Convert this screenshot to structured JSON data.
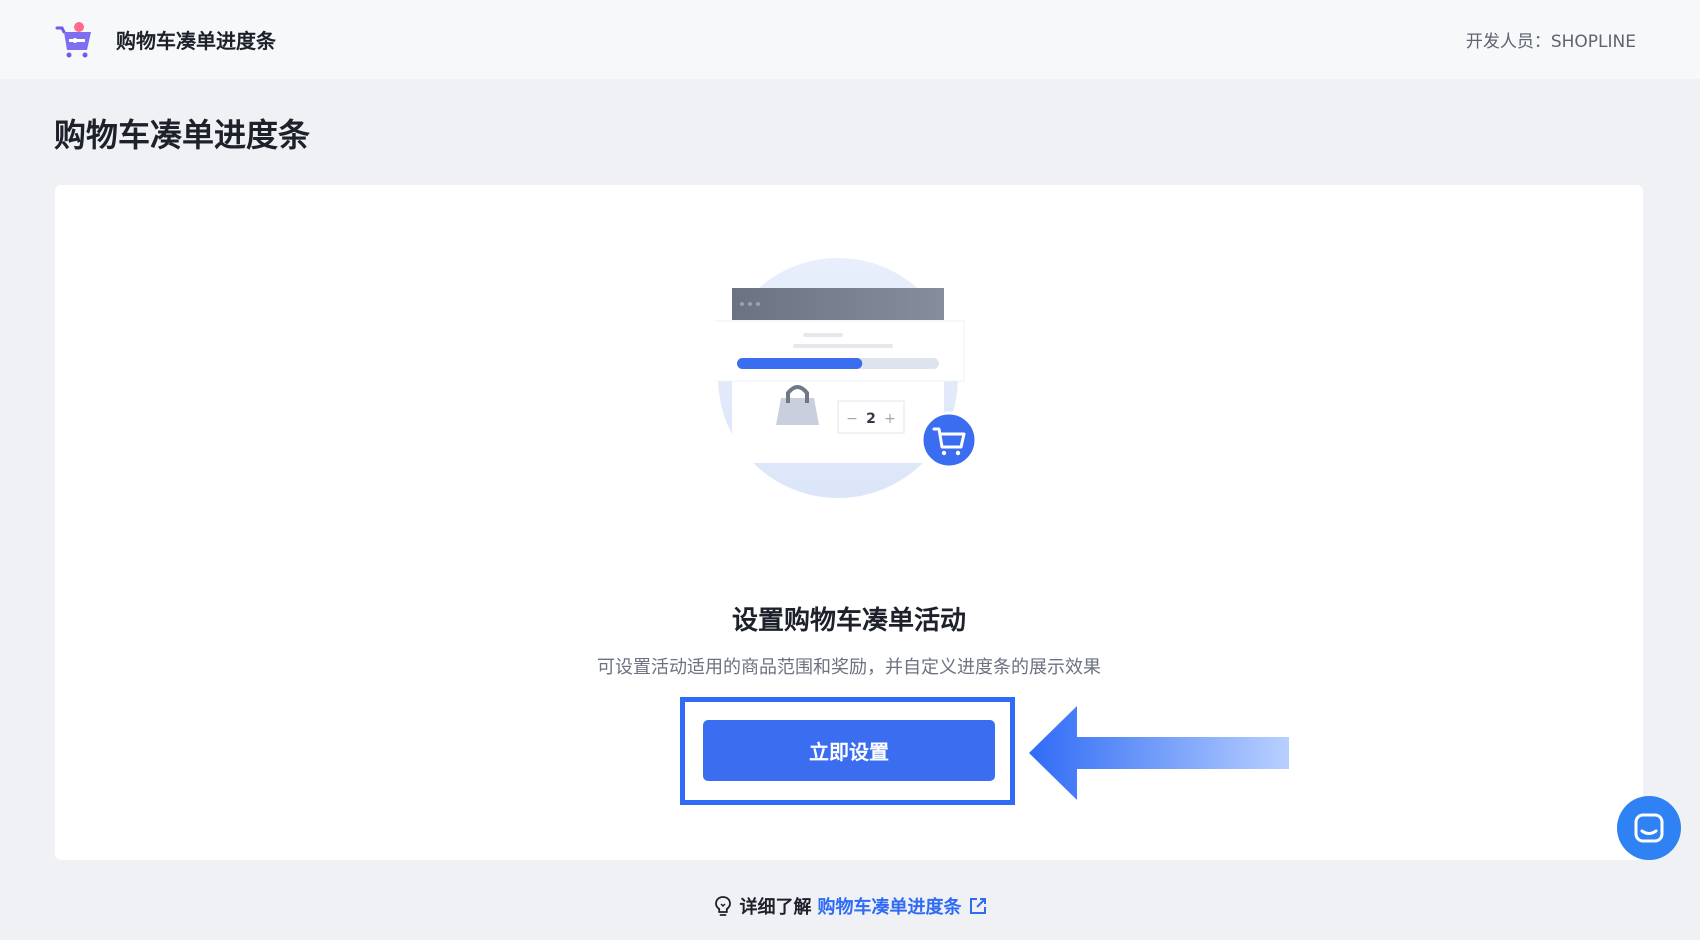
{
  "header": {
    "app_name": "购物车凑单进度条",
    "developer": "开发人员：SHOPLINE"
  },
  "page": {
    "title": "购物车凑单进度条"
  },
  "empty_state": {
    "illustration": {
      "quantity": "2",
      "minus": "−",
      "plus": "+",
      "progress_fill": 0.62
    },
    "title": "设置购物车凑单活动",
    "description": "可设置活动适用的商品范围和奖励，并自定义进度条的展示效果",
    "button_label": "立即设置"
  },
  "footer": {
    "prefix": "详细了解",
    "link_label": "购物车凑单进度条"
  },
  "icons": {
    "app_logo": "shopping-cart-icon",
    "bulb": "lightbulb-icon",
    "external": "external-link-icon",
    "chat": "chat-icon",
    "add_to_cart": "add-to-cart-icon",
    "bag": "shopping-bag-icon"
  },
  "colors": {
    "primary": "#3a6df0",
    "highlight": "#2f6bf5",
    "link": "#2f6bf5",
    "chat": "#2f82f3",
    "background": "#f0f1f5"
  }
}
